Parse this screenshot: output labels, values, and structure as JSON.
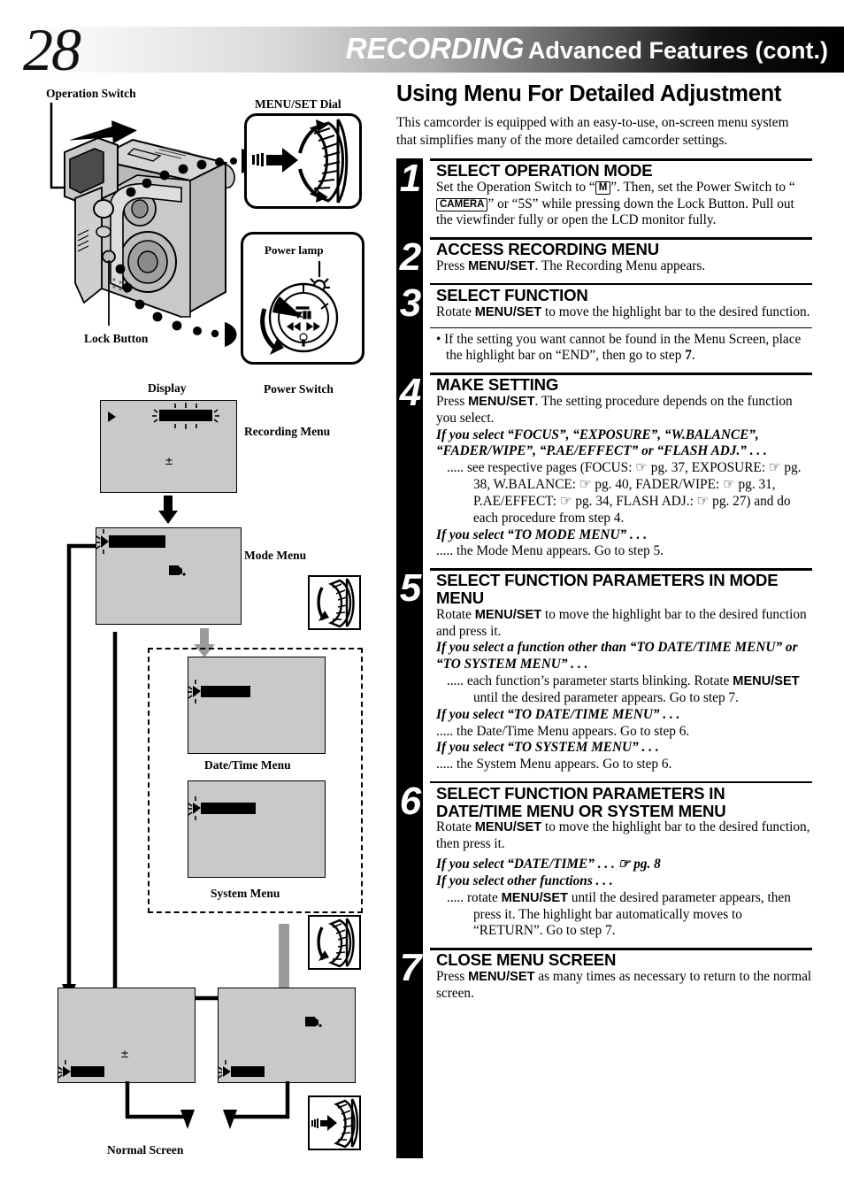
{
  "header": {
    "page_number": "28",
    "title_italic": "RECORDING",
    "title_bold": "Advanced Features (cont.)"
  },
  "diagram": {
    "labels": {
      "operation_switch": "Operation Switch",
      "menu_set_dial": "MENU/SET Dial",
      "power_lamp": "Power lamp",
      "lock_button": "Lock Button",
      "power_switch": "Power Switch",
      "display": "Display",
      "recording_menu": "Recording Menu",
      "mode_menu": "Mode Menu",
      "date_time_menu": "Date/Time Menu",
      "system_menu": "System Menu",
      "normal_screen": "Normal Screen"
    },
    "icons": {
      "dial_press": "dial-press-icon",
      "dial_rotate": "dial-rotate-icon",
      "power_dial": "power-switch-dial-icon",
      "camcorder": "camcorder-illustration"
    }
  },
  "intro": {
    "title": "Using Menu For Detailed Adjustment",
    "body": "This camcorder is equipped with an easy-to-use, on-screen menu system that simplifies many of the more detailed camcorder settings."
  },
  "steps": [
    {
      "num": "1",
      "heading": "SELECT OPERATION MODE",
      "body_pre": "Set the Operation Switch to “",
      "badge_m": "M",
      "body_mid": "”. Then, set the Power Switch to “",
      "badge_camera": "CAMERA",
      "body_post": "” or “5S” while pressing down the Lock Button. Pull out the viewfinder fully or open the LCD monitor fully."
    },
    {
      "num": "2",
      "heading": "ACCESS RECORDING MENU",
      "body_a": "Press ",
      "key": "MENU/SET",
      "body_b": ". The Recording Menu appears."
    },
    {
      "num": "3",
      "heading": "SELECT FUNCTION",
      "body_a": "Rotate ",
      "key": "MENU/SET",
      "body_b": " to move the highlight bar to the desired function.",
      "note": "• If the setting you want cannot be found in the Menu Screen, place the highlight bar on “END”, then go to step ",
      "note_step": "7",
      "note_end": "."
    },
    {
      "num": "4",
      "heading": "MAKE SETTING",
      "body_a": "Press ",
      "key": "MENU/SET",
      "body_b": ". The setting procedure depends on the function you select.",
      "cond1": "If you select “FOCUS”, “EXPOSURE”, “W.BALANCE”, “FADER/WIPE”, “P.AE/EFFECT” or “FLASH ADJ.” . . .",
      "cond1_body": "..... see respective pages (FOCUS: ☞ pg. 37, EXPOSURE: ☞ pg. 38, W.BALANCE: ☞ pg. 40, FADER/WIPE: ☞ pg. 31, P.AE/EFFECT: ☞ pg. 34, FLASH ADJ.: ☞ pg. 27) and do each procedure from step 4.",
      "cond2": "If you select “TO MODE MENU” . . .",
      "cond2_body": "..... the Mode Menu appears. Go to step 5."
    },
    {
      "num": "5",
      "heading": "SELECT FUNCTION PARAMETERS IN MODE MENU",
      "body_a": "Rotate ",
      "key": "MENU/SET",
      "body_b": " to move the highlight bar to the desired function and press it.",
      "cond1": "If you select a function other than “TO DATE/TIME MENU” or “TO SYSTEM MENU” . . .",
      "cond1_body_a": "..... each function’s parameter starts blinking. Rotate ",
      "cond1_key": "MENU/SET",
      "cond1_body_b": " until the desired parameter appears. Go to step 7.",
      "cond2": "If you select “TO DATE/TIME MENU” . . .",
      "cond2_body": "..... the Date/Time Menu appears. Go to step 6.",
      "cond3": "If you select “TO SYSTEM MENU” . . .",
      "cond3_body": "..... the System Menu appears. Go to step 6."
    },
    {
      "num": "6",
      "heading": "SELECT FUNCTION PARAMETERS IN DATE/TIME MENU OR SYSTEM MENU",
      "body_a": "Rotate ",
      "key": "MENU/SET",
      "body_b": " to move the highlight bar to the desired function, then press it.",
      "cond1": "If you select “DATE/TIME” . . . ☞ pg. 8",
      "cond2": "If you select other functions . . .",
      "cond2_body_a": "..... rotate ",
      "cond2_key": "MENU/SET",
      "cond2_body_b": " until the desired parameter appears, then press it. The highlight bar automatically moves to “RETURN”. Go to step 7."
    },
    {
      "num": "7",
      "heading": "CLOSE MENU SCREEN",
      "body_a": "Press ",
      "key": "MENU/SET",
      "body_b": " as many times as necessary to return to the normal screen."
    }
  ],
  "colors": {
    "screen_gray": "#c9c9c9",
    "bar_black": "#000000",
    "gray_arrow": "#9a9a9a"
  }
}
